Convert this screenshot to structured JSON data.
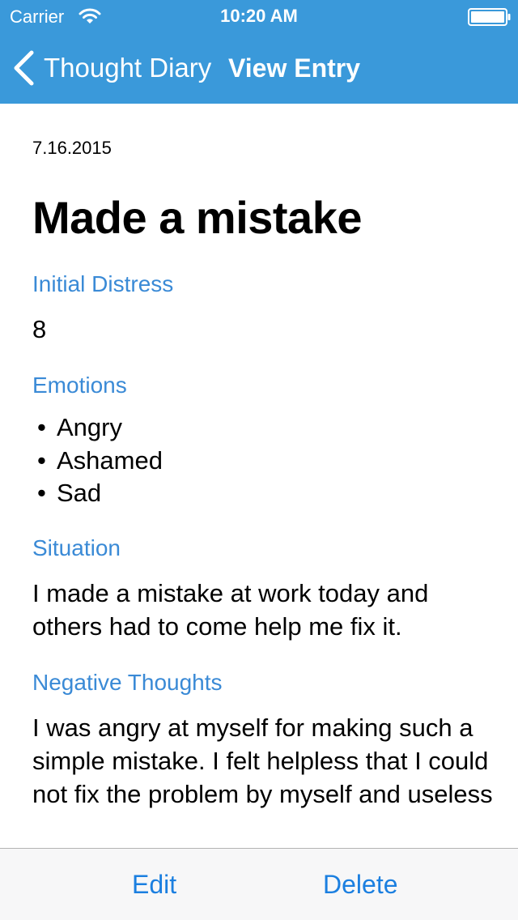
{
  "status_bar": {
    "carrier": "Carrier",
    "time": "10:20 AM",
    "icons": [
      "wifi-icon",
      "battery-icon"
    ]
  },
  "nav_bar": {
    "back_label": "Thought Diary",
    "title": "View Entry",
    "back_icon": "chevron-left-icon"
  },
  "entry": {
    "date": "7.16.2015",
    "title": "Made a mistake",
    "initial_distress": {
      "label": "Initial Distress",
      "value": "8"
    },
    "emotions": {
      "label": "Emotions",
      "items": [
        "Angry",
        "Ashamed",
        "Sad"
      ]
    },
    "situation": {
      "label": "Situation",
      "text": "I made a mistake at work today and others had to come help me fix it."
    },
    "negative_thoughts": {
      "label": "Negative Thoughts",
      "text": "I was angry at myself for making such a simple mistake. I felt helpless that I could not fix the problem by myself and useless"
    }
  },
  "toolbar": {
    "edit_label": "Edit",
    "delete_label": "Delete"
  },
  "colors": {
    "nav_background": "#3a99da",
    "section_label": "#3a8ad6",
    "toolbar_tint": "#1b7fe0",
    "toolbar_background": "#f7f7f8"
  }
}
